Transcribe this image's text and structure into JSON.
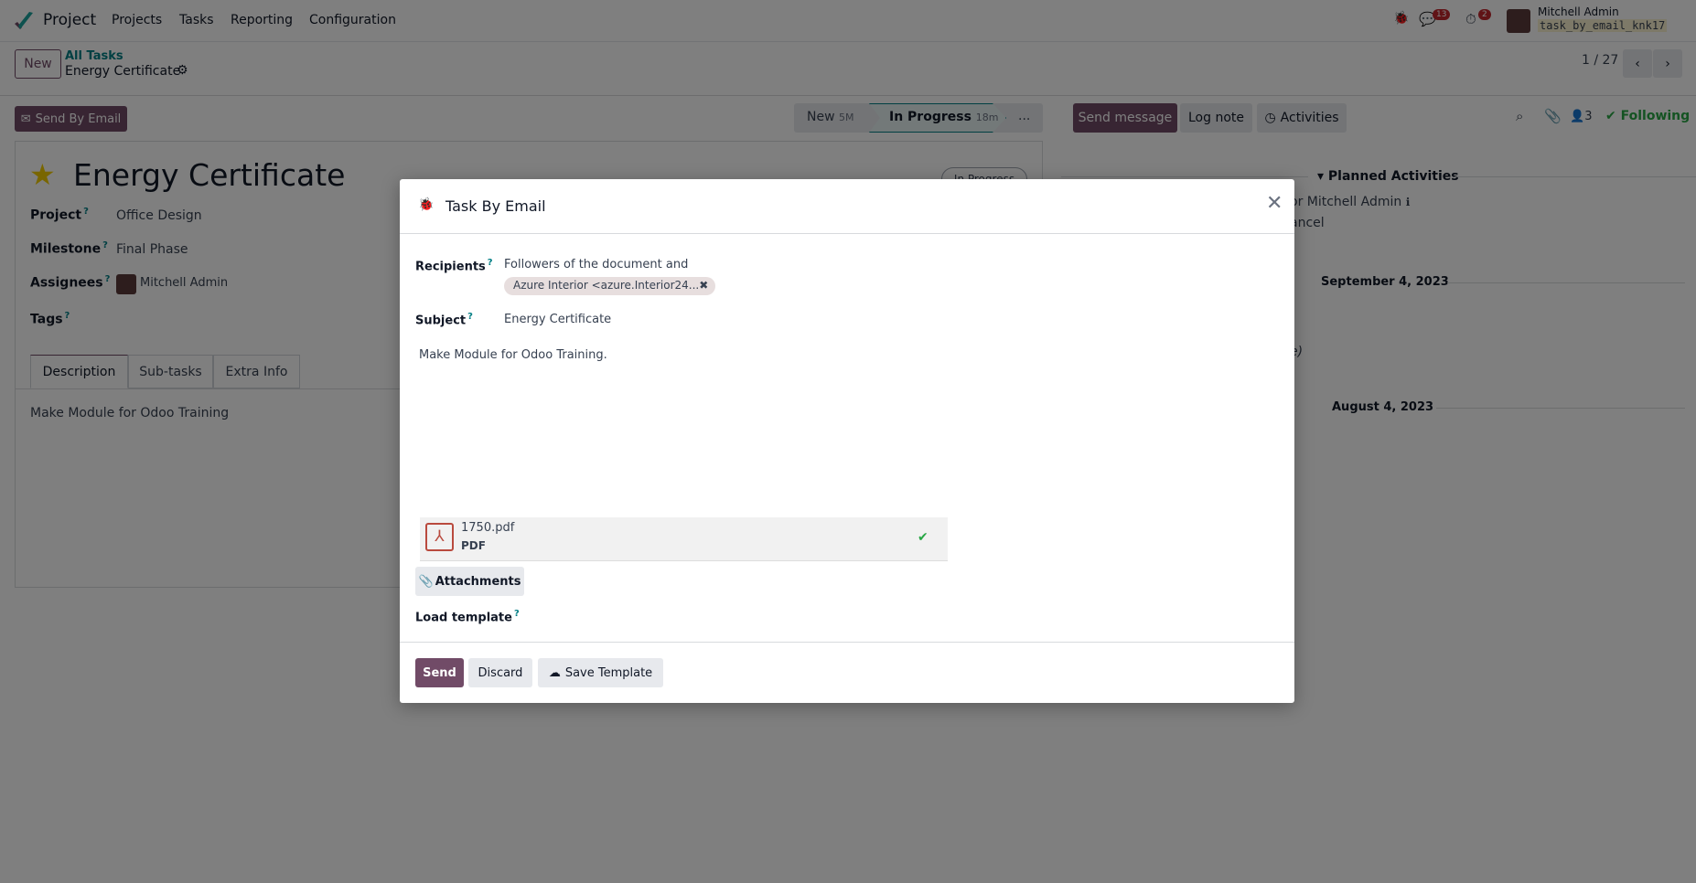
{
  "navbar": {
    "app": "Project",
    "menu": [
      "Projects",
      "Tasks",
      "Reporting",
      "Configuration"
    ],
    "messages_count": "13",
    "activities_count": "2",
    "user": "Mitchell Admin",
    "database": "task_by_email_knk17"
  },
  "control": {
    "new_label": "New",
    "breadcrumb_parent": "All Tasks",
    "breadcrumb_current": "Energy Certificate",
    "pager": "1 / 27"
  },
  "actions": {
    "send_by_email": "Send By Email"
  },
  "statusbar": {
    "stages": [
      {
        "label": "New",
        "duration": "5M"
      },
      {
        "label": "In Progress",
        "duration": "18m",
        "active": true
      }
    ],
    "more": "..."
  },
  "chatter": {
    "send_message": "Send message",
    "log_note": "Log note",
    "activities": "Activities",
    "followers_count": "3",
    "following": "Following",
    "planned_activities": "Planned Activities",
    "activity_line": "or Mitchell Admin",
    "activity_line2": "ancel",
    "date1": "September 4, 2023",
    "fragment": "e)",
    "date2": "August 4, 2023"
  },
  "form": {
    "title": "Energy Certificate",
    "state_badge": "In Progress",
    "fields": [
      {
        "label": "Project",
        "value": "Office Design"
      },
      {
        "label": "Milestone",
        "value": "Final Phase"
      },
      {
        "label": "Assignees",
        "value": "Mitchell Admin"
      },
      {
        "label": "Tags",
        "value": ""
      }
    ],
    "tabs": [
      "Description",
      "Sub-tasks",
      "Extra Info"
    ],
    "description": "Make Module for Odoo Training"
  },
  "dialog": {
    "title": "Task By Email",
    "recipients_label": "Recipients",
    "recipients_text": "Followers of the document and",
    "recipient_tag": "Azure Interior <azure.Interior24...",
    "subject_label": "Subject",
    "subject": "Energy Certificate",
    "body": "Make Module for Odoo Training.",
    "attachment": {
      "name": "1750.pdf",
      "type": "PDF"
    },
    "attachments_button": "Attachments",
    "load_template_label": "Load template",
    "send": "Send",
    "discard": "Discard",
    "save_template": "Save Template"
  },
  "colors": {
    "primary": "#714b67",
    "accent": "#017e84",
    "success": "#28a745",
    "danger": "#c0262d"
  }
}
